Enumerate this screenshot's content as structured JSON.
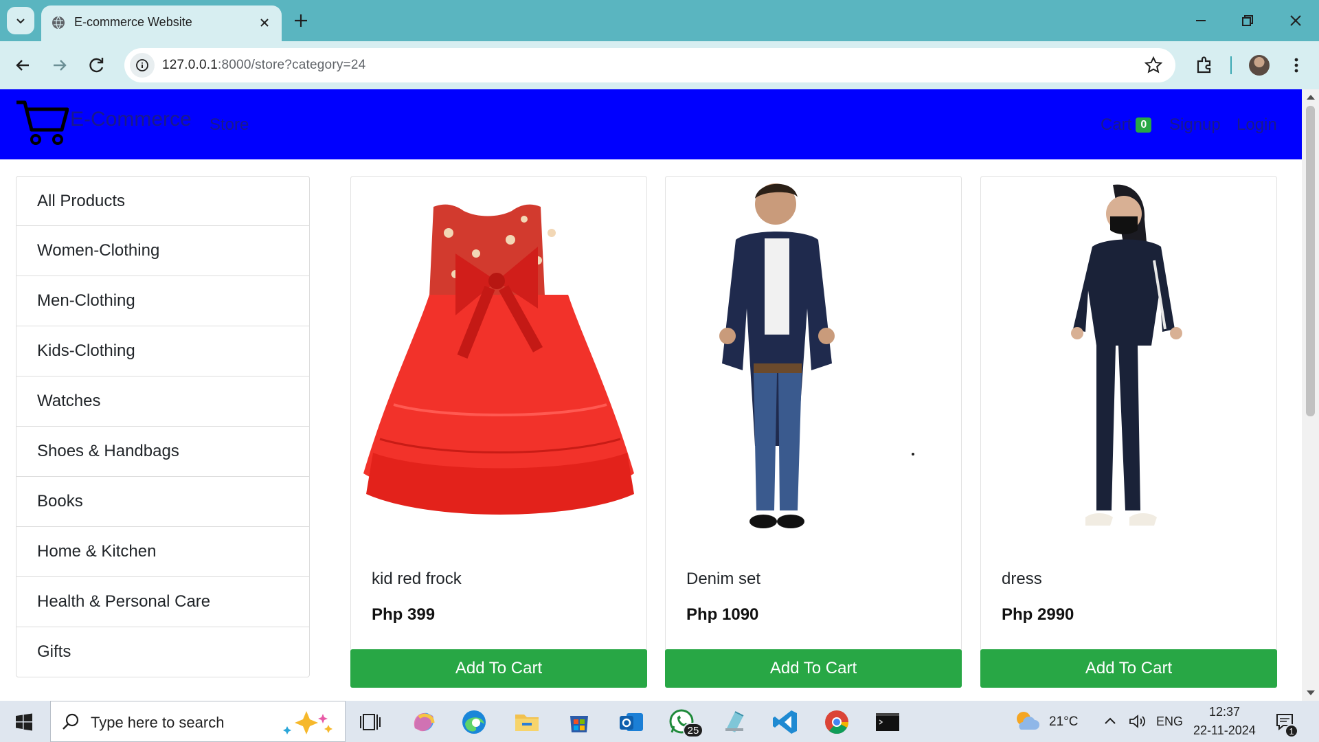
{
  "browser": {
    "tab_title": "E-commerce Website",
    "url_host": "127.0.0.1",
    "url_rest": ":8000/store?category=24"
  },
  "site": {
    "brand": "E-Commerce",
    "nav_store": "Store",
    "nav_cart": "Cart",
    "cart_count": "0",
    "nav_signup": "Signup",
    "nav_login": "Login"
  },
  "categories": [
    "All Products",
    "Women-Clothing",
    "Men-Clothing",
    "Kids-Clothing",
    "Watches",
    "Shoes & Handbags",
    "Books",
    "Home & Kitchen",
    "Health & Personal Care",
    "Gifts"
  ],
  "products": [
    {
      "name": "kid red frock",
      "price": "Php 399",
      "button": "Add To Cart"
    },
    {
      "name": "Denim set",
      "price": "Php 1090",
      "button": "Add To Cart"
    },
    {
      "name": "dress",
      "price": "Php 2990",
      "button": "Add To Cart"
    }
  ],
  "taskbar": {
    "search_placeholder": "Type here to search",
    "whatsapp_badge": "25",
    "weather": "21°C",
    "lang": "ENG",
    "time": "12:37",
    "date": "22-11-2024",
    "notif_count": "1"
  },
  "colors": {
    "navbar": "#0000ff",
    "button_green": "#28a745",
    "chrome_teal": "#5ab5c0"
  }
}
